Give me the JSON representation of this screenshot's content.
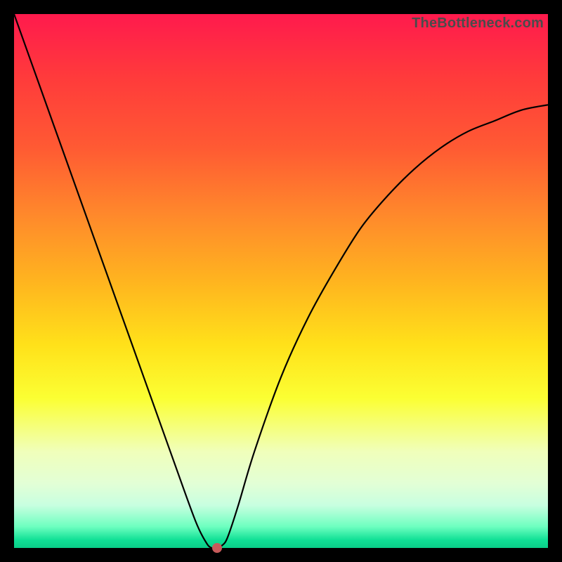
{
  "watermark": "TheBottleneck.com",
  "chart_data": {
    "type": "line",
    "title": "",
    "xlabel": "",
    "ylabel": "",
    "xlim": [
      0,
      100
    ],
    "ylim": [
      0,
      100
    ],
    "series": [
      {
        "name": "curve",
        "x": [
          0,
          5,
          10,
          15,
          20,
          25,
          30,
          34,
          36,
          37,
          38,
          39,
          40,
          42,
          45,
          50,
          55,
          60,
          65,
          70,
          75,
          80,
          85,
          90,
          95,
          100
        ],
        "values": [
          100,
          86,
          72,
          58,
          44,
          30,
          16,
          5,
          1,
          0,
          0,
          0.5,
          2,
          8,
          18,
          32,
          43,
          52,
          60,
          66,
          71,
          75,
          78,
          80,
          82,
          83
        ]
      }
    ],
    "marker": {
      "x": 38,
      "y": 0
    },
    "gradient_stops": [
      {
        "pct": 0,
        "color": "#ff1a4d"
      },
      {
        "pct": 12,
        "color": "#ff3b3b"
      },
      {
        "pct": 25,
        "color": "#ff5a33"
      },
      {
        "pct": 38,
        "color": "#ff8a2b"
      },
      {
        "pct": 50,
        "color": "#ffb41f"
      },
      {
        "pct": 62,
        "color": "#ffe11a"
      },
      {
        "pct": 72,
        "color": "#fbff33"
      },
      {
        "pct": 82,
        "color": "#f0ffbb"
      },
      {
        "pct": 88,
        "color": "#e2ffd6"
      },
      {
        "pct": 92,
        "color": "#c8ffe0"
      },
      {
        "pct": 96,
        "color": "#6effc0"
      },
      {
        "pct": 98.5,
        "color": "#10e095"
      },
      {
        "pct": 100,
        "color": "#0acd88"
      }
    ]
  }
}
